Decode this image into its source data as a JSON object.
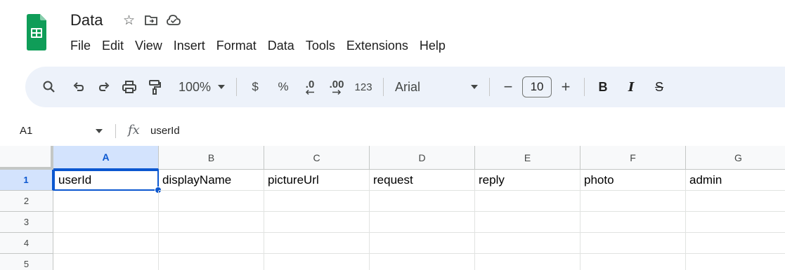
{
  "document": {
    "title": "Data",
    "icons": [
      "star-icon",
      "move-to-folder-icon",
      "cloud-saved-icon"
    ]
  },
  "menu": [
    "File",
    "Edit",
    "View",
    "Insert",
    "Format",
    "Data",
    "Tools",
    "Extensions",
    "Help"
  ],
  "toolbar": {
    "zoom": "100%",
    "currency": "$",
    "percent": "%",
    "decrease_decimal": ".0",
    "increase_decimal": ".00",
    "number_format": "123",
    "font": "Arial",
    "font_size": "10",
    "minus": "−",
    "plus": "+",
    "bold": "B",
    "italic": "I",
    "strikethrough": "S"
  },
  "formula_bar": {
    "cell_ref": "A1",
    "fx": "fx",
    "content": "userId"
  },
  "grid": {
    "columns": [
      "A",
      "B",
      "C",
      "D",
      "E",
      "F",
      "G"
    ],
    "rows": [
      "1",
      "2",
      "3",
      "4",
      "5"
    ],
    "selected_cell": "A1",
    "values": [
      [
        "userId",
        "displayName",
        "pictureUrl",
        "request",
        "reply",
        "photo",
        "admin"
      ],
      [
        "",
        "",
        "",
        "",
        "",
        "",
        ""
      ],
      [
        "",
        "",
        "",
        "",
        "",
        "",
        ""
      ],
      [
        "",
        "",
        "",
        "",
        "",
        "",
        ""
      ],
      [
        "",
        "",
        "",
        "",
        "",
        "",
        ""
      ]
    ]
  },
  "colors": {
    "accent": "#0b57d0",
    "toolbar_bg": "#edf2fa",
    "logo_green": "#0f9d58"
  }
}
